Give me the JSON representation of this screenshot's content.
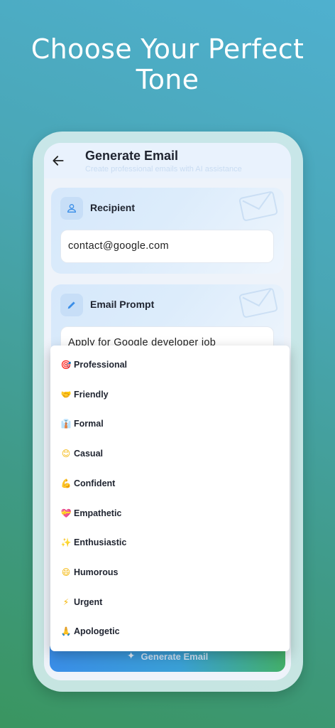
{
  "promo": {
    "title": "Choose Your Perfect Tone"
  },
  "appbar": {
    "title": "Generate Email",
    "subtitle": "Create professional emails with AI assistance"
  },
  "recipient": {
    "label": "Recipient",
    "value": "contact@google.com"
  },
  "prompt": {
    "label": "Email Prompt",
    "value": "Apply for Google developer job"
  },
  "generate": {
    "label": "Generate Email"
  },
  "tones": [
    {
      "emoji": "🎯",
      "label": "Professional",
      "color": "#e53935"
    },
    {
      "emoji": "🤝",
      "label": "Friendly",
      "color": "#f4b400"
    },
    {
      "emoji": "👔",
      "label": "Formal",
      "color": "#3f7fc4"
    },
    {
      "emoji": "😊",
      "label": "Casual",
      "color": "#f4b400"
    },
    {
      "emoji": "💪",
      "label": "Confident",
      "color": "#f4b400"
    },
    {
      "emoji": "💝",
      "label": "Empathetic",
      "color": "#e53978"
    },
    {
      "emoji": "✨",
      "label": "Enthusiastic",
      "color": "#f4b400"
    },
    {
      "emoji": "😄",
      "label": "Humorous",
      "color": "#f4b400"
    },
    {
      "emoji": "⚡",
      "label": "Urgent",
      "color": "#f4b400"
    },
    {
      "emoji": "🙏",
      "label": "Apologetic",
      "color": "#f4b400"
    }
  ],
  "colors": {
    "accent": "#3a8ee8",
    "success": "#43b06a",
    "background": "#eef3fa"
  }
}
